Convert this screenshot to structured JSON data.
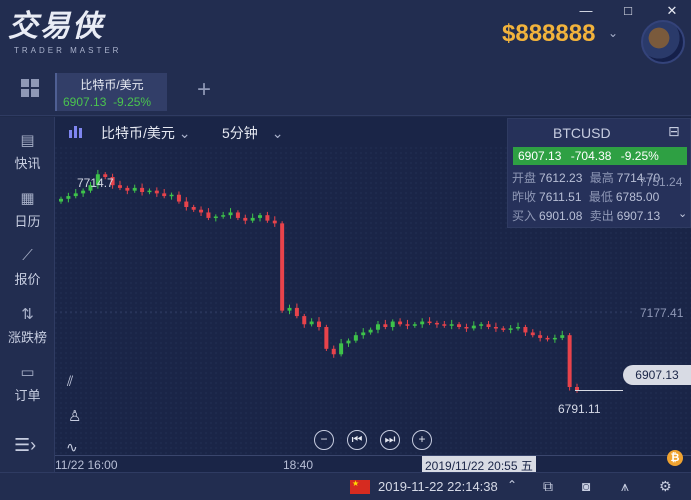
{
  "app": {
    "logo_title": "交易侠",
    "logo_subtitle": "TRADER MASTER",
    "balance": "$888888"
  },
  "window_controls": {
    "minimize": "—",
    "maximize": "□",
    "close": "✕"
  },
  "tab": {
    "name": "比特币/美元",
    "price": "6907.13",
    "change": "-9.25%",
    "add": "+"
  },
  "sidebar": {
    "items": [
      {
        "label": "快讯",
        "icon": "news-icon"
      },
      {
        "label": "日历",
        "icon": "calendar-icon"
      },
      {
        "label": "报价",
        "icon": "quote-icon"
      },
      {
        "label": "涨跌榜",
        "icon": "ranking-icon"
      },
      {
        "label": "订单",
        "icon": "order-icon"
      }
    ]
  },
  "chart_header": {
    "symbol": "比特币/美元",
    "period": "5分钟"
  },
  "quote_panel": {
    "title": "BTCUSD",
    "price": "6907.13",
    "change": "-704.38",
    "change_pct": "-9.25%",
    "rows": [
      {
        "k1": "开盘",
        "v1": "7612.23",
        "k2": "最高",
        "v2": "7714.70"
      },
      {
        "k1": "昨收",
        "v1": "7611.51",
        "k2": "最低",
        "v2": "6785.00"
      },
      {
        "k1": "买入",
        "v1": "6901.08",
        "k2": "卖出",
        "v2": "6907.13"
      }
    ]
  },
  "chart_data": {
    "type": "candlestick",
    "y_labels": [
      "7751.24",
      "7177.41"
    ],
    "current_price_label": "6907.13",
    "high_annotation": "7714.7",
    "low_annotation": "6791.11",
    "ylim": [
      6700,
      7800
    ],
    "x_labels": [
      "11/22 16:00",
      "18:40"
    ],
    "cursor_time": "2019/11/22 20:55 五",
    "colors": {
      "up": "#3ec34a",
      "down": "#e8434b",
      "last_price": "#d8dbe4"
    }
  },
  "status": {
    "time": "2019-11-22 22:14:38",
    "flag": "★"
  }
}
